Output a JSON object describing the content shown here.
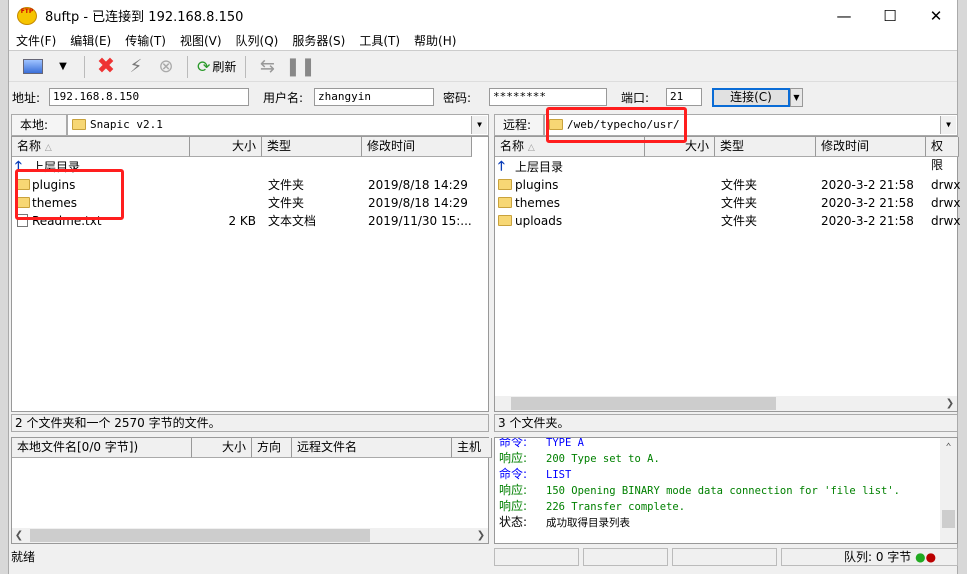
{
  "window": {
    "title": "8uftp - 已连接到 192.168.8.150",
    "logo_text": "FTP"
  },
  "menu": [
    "文件(F)",
    "编辑(E)",
    "传输(T)",
    "视图(V)",
    "队列(Q)",
    "服务器(S)",
    "工具(T)",
    "帮助(H)"
  ],
  "toolbar": {
    "refresh_label": "刷新"
  },
  "connection": {
    "address_label": "地址:",
    "address": "192.168.8.150",
    "user_label": "用户名:",
    "user": "zhangyin",
    "password_label": "密码:",
    "password": "********",
    "port_label": "端口:",
    "port": "21",
    "connect_label": "连接(C)"
  },
  "local": {
    "path_label": "本地:",
    "path": "Snapic v2.1",
    "columns": [
      "名称",
      "大小",
      "类型",
      "修改时间"
    ],
    "up_label": "上层目录",
    "rows": [
      {
        "name": "plugins",
        "size": "",
        "type": "文件夹",
        "modified": "2019/8/18 14:29",
        "icon": "folder"
      },
      {
        "name": "themes",
        "size": "",
        "type": "文件夹",
        "modified": "2019/8/18 14:29",
        "icon": "folder"
      },
      {
        "name": "Readme.txt",
        "size": "2 KB",
        "type": "文本文档",
        "modified": "2019/11/30 15:...",
        "icon": "text-file"
      }
    ],
    "status": "2 个文件夹和一个 2570 字节的文件。"
  },
  "remote": {
    "path_label": "远程:",
    "path": "/web/typecho/usr/",
    "columns": [
      "名称",
      "大小",
      "类型",
      "修改时间",
      "权限"
    ],
    "up_label": "上层目录",
    "rows": [
      {
        "name": "plugins",
        "type": "文件夹",
        "modified": "2020-3-2 21:58",
        "perm": "drwx"
      },
      {
        "name": "themes",
        "type": "文件夹",
        "modified": "2020-3-2 21:58",
        "perm": "drwx"
      },
      {
        "name": "uploads",
        "type": "文件夹",
        "modified": "2020-3-2 21:58",
        "perm": "drwx"
      }
    ],
    "status": "3 个文件夹。"
  },
  "queue": {
    "columns": [
      "本地文件名[0/0 字节])",
      "大小",
      "方向",
      "远程文件名",
      "主机"
    ]
  },
  "log": [
    {
      "kind": "命令:",
      "text": "TYPE A",
      "color": "#0000ff"
    },
    {
      "kind": "响应:",
      "text": "200 Type set to A.",
      "color": "#008000"
    },
    {
      "kind": "命令:",
      "text": "LIST",
      "color": "#0000ff"
    },
    {
      "kind": "响应:",
      "text": "150 Opening BINARY mode data connection for 'file list'.",
      "color": "#008000"
    },
    {
      "kind": "响应:",
      "text": "226 Transfer complete.",
      "color": "#008000"
    },
    {
      "kind": "状态:",
      "text": "成功取得目录列表",
      "color": "#000000"
    }
  ],
  "statusbar": {
    "ready": "就绪",
    "queue": "队列: 0 字节"
  },
  "annotation_color": "#ff1e1e"
}
